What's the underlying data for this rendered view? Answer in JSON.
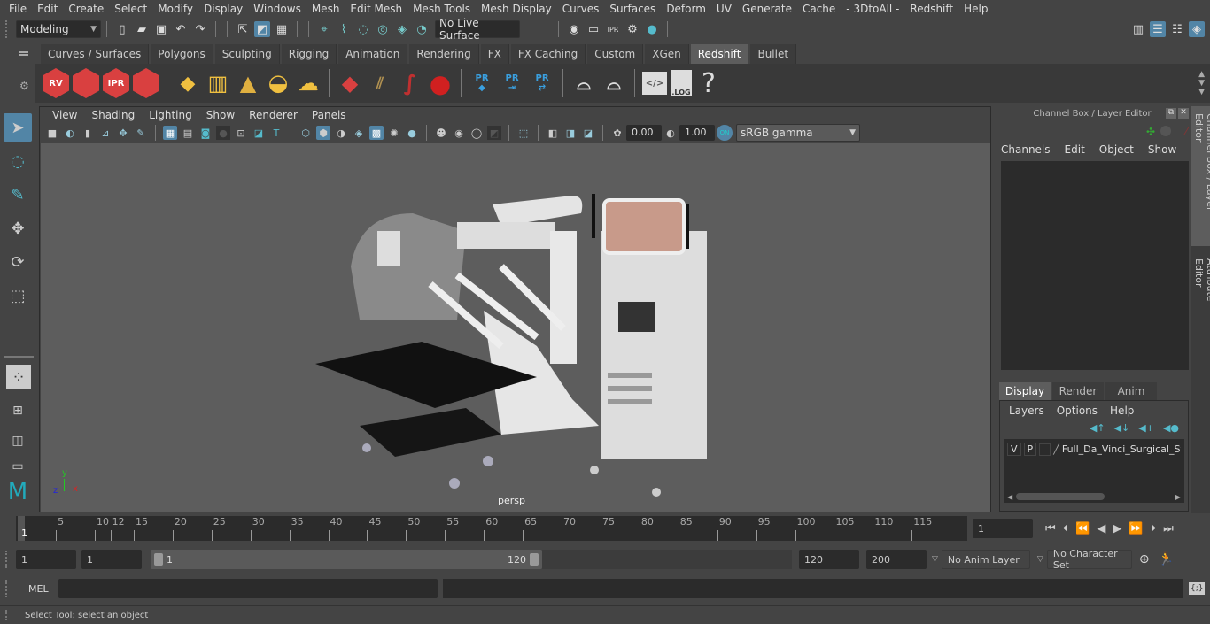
{
  "menubar": {
    "items": [
      "File",
      "Edit",
      "Create",
      "Select",
      "Modify",
      "Display",
      "Windows",
      "Mesh",
      "Edit Mesh",
      "Mesh Tools",
      "Mesh Display",
      "Curves",
      "Surfaces",
      "Deform",
      "UV",
      "Generate",
      "Cache",
      "- 3DtoAll -",
      "Redshift",
      "Help"
    ]
  },
  "statusline": {
    "mode_selector": "Modeling",
    "live_surface": "No Live Surface"
  },
  "shelf": {
    "tabs": [
      "Curves / Surfaces",
      "Polygons",
      "Sculpting",
      "Rigging",
      "Animation",
      "Rendering",
      "FX",
      "FX Caching",
      "Custom",
      "XGen",
      "Redshift",
      "Bullet"
    ],
    "active_tab": "Redshift",
    "buttons": [
      {
        "icon": "rs-render-view-icon",
        "label": "RV"
      },
      {
        "icon": "rs-batch-render-icon",
        "label": ""
      },
      {
        "icon": "rs-ipr-icon",
        "label": "IPR"
      },
      {
        "icon": "rs-settings-icon",
        "label": ""
      },
      {
        "icon": "rs-area-light-icon",
        "label": ""
      },
      {
        "icon": "rs-portal-light-icon",
        "label": ""
      },
      {
        "icon": "rs-spot-light-icon",
        "label": ""
      },
      {
        "icon": "rs-dome-light-icon",
        "label": ""
      },
      {
        "icon": "rs-sun-sky-icon",
        "label": ""
      },
      {
        "icon": "rs-proxy-icon",
        "label": ""
      },
      {
        "icon": "rs-hair-icon",
        "label": ""
      },
      {
        "icon": "rs-curve-icon",
        "label": ""
      },
      {
        "icon": "rs-sphere-icon",
        "label": ""
      },
      {
        "icon": "rs-proxy-pr-icon",
        "label": "PR"
      },
      {
        "icon": "rs-proxy-export-icon",
        "label": "PR"
      },
      {
        "icon": "rs-proxy-swap-icon",
        "label": "PR"
      },
      {
        "icon": "rs-baking-multi-icon",
        "label": ""
      },
      {
        "icon": "rs-baking-icon",
        "label": ""
      },
      {
        "icon": "rs-shader-code-icon",
        "label": ""
      },
      {
        "icon": "rs-log-icon",
        "label": ".LOG"
      },
      {
        "icon": "help-icon",
        "label": "?"
      }
    ]
  },
  "viewport": {
    "menu": [
      "View",
      "Shading",
      "Lighting",
      "Show",
      "Renderer",
      "Panels"
    ],
    "exposure": "0.00",
    "gamma": "1.00",
    "color_mgmt": "ON",
    "color_space": "sRGB gamma",
    "camera_label": "persp",
    "axis": {
      "x": "x",
      "y": "y",
      "z": "z"
    }
  },
  "channel_box": {
    "title": "Channel Box / Layer Editor",
    "menu": [
      "Channels",
      "Edit",
      "Object",
      "Show"
    ]
  },
  "layer_editor": {
    "tabs": [
      "Display",
      "Render",
      "Anim"
    ],
    "active_tab": "Display",
    "menu": [
      "Layers",
      "Options",
      "Help"
    ],
    "layers": [
      {
        "v": "V",
        "p": "P",
        "name": "Full_Da_Vinci_Surgical_Sys"
      }
    ]
  },
  "side_tabs": [
    "Channel Box / Layer Editor",
    "Attribute Editor"
  ],
  "timeline": {
    "ticks": [
      5,
      10,
      15,
      20,
      25,
      30,
      35,
      40,
      45,
      50,
      55,
      60,
      65,
      70,
      75,
      80,
      85,
      90,
      95,
      100,
      105,
      110,
      115,
      "12"
    ],
    "current_marker": "1",
    "current_frame": "1"
  },
  "range": {
    "start": "1",
    "playback_start": "1",
    "slider_min": "1",
    "slider_max": "120",
    "playback_end": "120",
    "end": "200",
    "anim_layer": "No Anim Layer",
    "character_set": "No Character Set"
  },
  "command": {
    "language": "MEL"
  },
  "help_line": "Select Tool: select an object"
}
